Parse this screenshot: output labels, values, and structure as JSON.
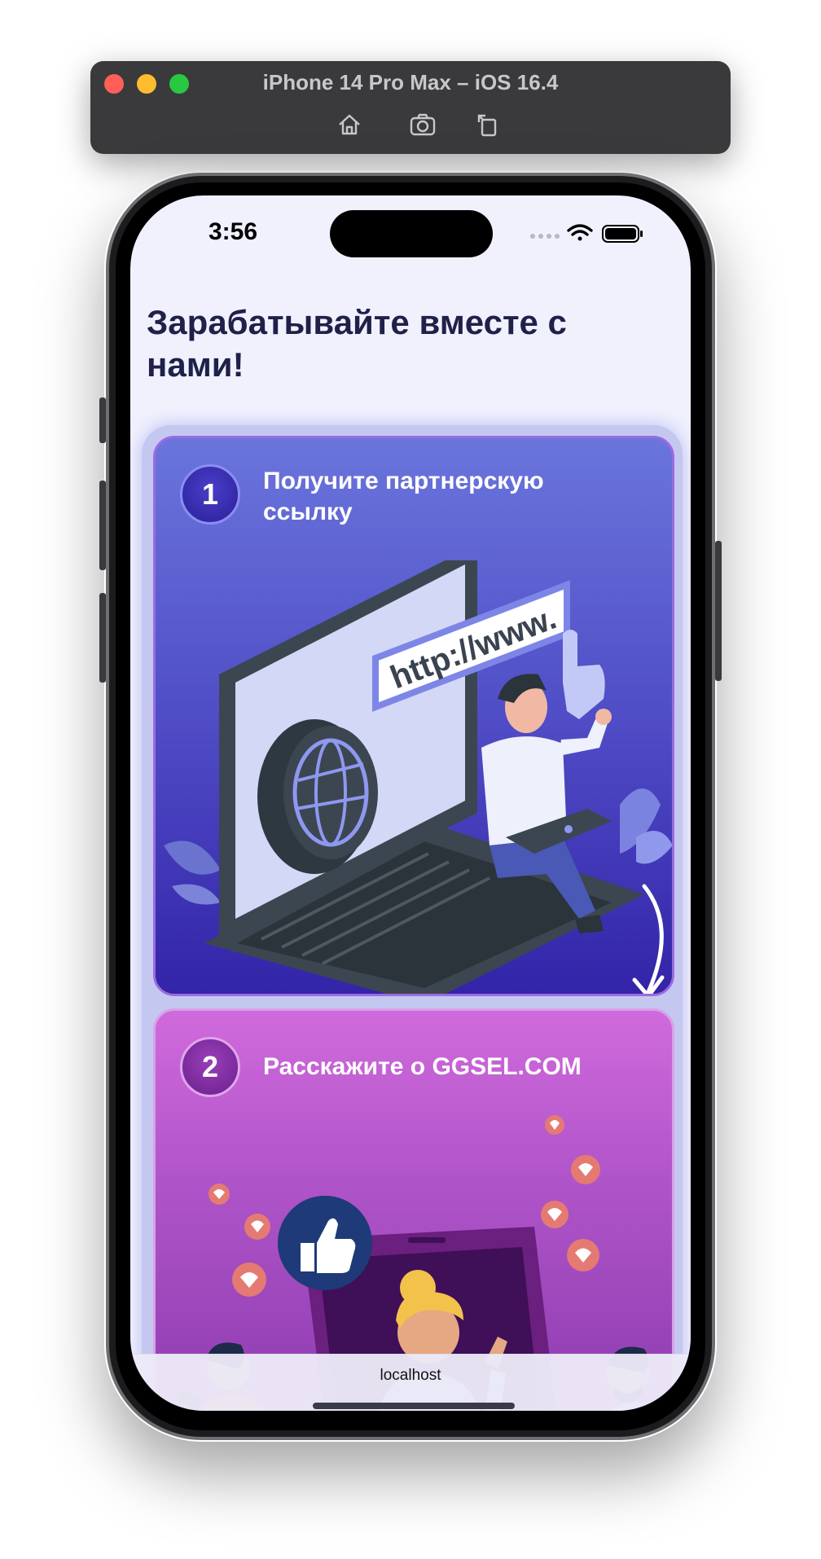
{
  "simulator": {
    "title": "iPhone 14 Pro Max – iOS 16.4",
    "tools": [
      "home-icon",
      "screenshot-icon",
      "rotate-icon"
    ]
  },
  "status_bar": {
    "time": "3:56",
    "icons": [
      "signal-dots-icon",
      "wifi-icon",
      "battery-icon"
    ]
  },
  "page": {
    "title": "Зарабатывайте вместе с нами!"
  },
  "steps": [
    {
      "number": "1",
      "text": "Получите партнерскую ссылку",
      "illustration_text": "http://www."
    },
    {
      "number": "2",
      "text": "Расскажите о GGSEL.COM"
    }
  ],
  "browser": {
    "url": "localhost"
  },
  "colors": {
    "title": "#1f2149",
    "step1_top": "#6a75dc",
    "step1_bottom": "#3324a8",
    "step2_top": "#d06adc",
    "step2_bottom": "#8a3aae"
  }
}
